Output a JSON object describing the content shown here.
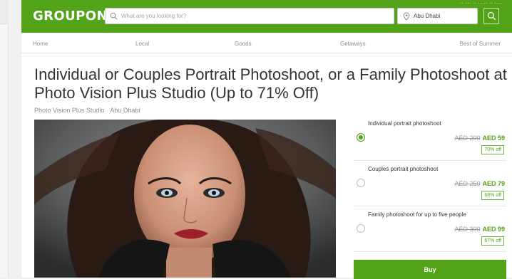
{
  "header": {
    "logo": "GROUPON",
    "search_placeholder": "What are you looking for?",
    "location": "Abu Dhabi"
  },
  "nav": [
    "Home",
    "Local",
    "Goods",
    "Getaways",
    "Best of Summer"
  ],
  "deal": {
    "title": "Individual or Couples Portrait Photoshoot, or a Family Photoshoot at Photo Vision Plus Studio (Up to 71% Off)",
    "merchant": "Photo Vision Plus Studio",
    "city": "Abu Dhabi"
  },
  "options": [
    {
      "name": "Individual portrait photoshoot",
      "old_price": "AED 200",
      "new_price": "AED 59",
      "discount": "70% off",
      "selected": true
    },
    {
      "name": "Couples portrait photoshoot",
      "old_price": "AED 250",
      "new_price": "AED 79",
      "discount": "68% off",
      "selected": false
    },
    {
      "name": "Family photoshoot for up to five people",
      "old_price": "AED 300",
      "new_price": "AED 99",
      "discount": "67% off",
      "selected": false
    }
  ],
  "buy_label": "Buy",
  "colors": {
    "brand": "#53a318",
    "price": "#53a318",
    "strike": "#9a9a9a"
  }
}
